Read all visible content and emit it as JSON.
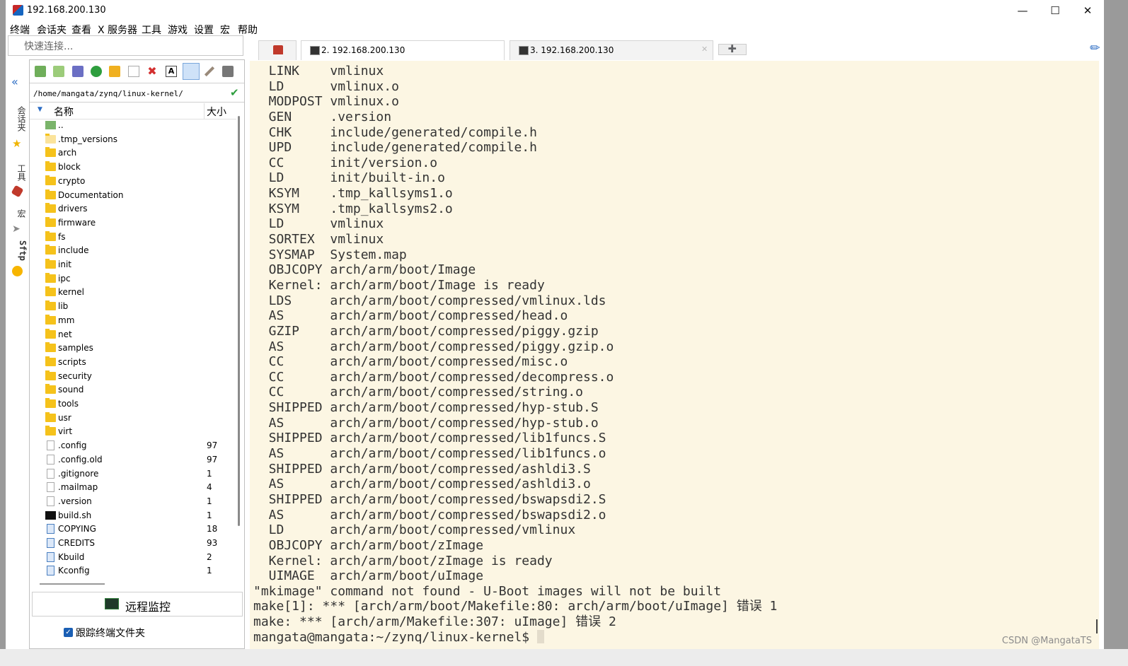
{
  "window": {
    "title": "192.168.200.130"
  },
  "menu": [
    "终端",
    "会话夹",
    "查看",
    "X 服务器",
    "工具",
    "游戏",
    "设置",
    "宏",
    "帮助"
  ],
  "quick_connect": {
    "placeholder": "快速连接..."
  },
  "side_tabs": [
    "会话夹",
    "工具",
    "宏",
    "Sftp"
  ],
  "sftp": {
    "path": "/home/mangata/zynq/linux-kernel/",
    "col_name": "名称",
    "col_size": "大小",
    "files": [
      {
        "name": "..",
        "size": "",
        "type": "up"
      },
      {
        "name": ".tmp_versions",
        "size": "",
        "type": "folder-light"
      },
      {
        "name": "arch",
        "size": "",
        "type": "folder"
      },
      {
        "name": "block",
        "size": "",
        "type": "folder"
      },
      {
        "name": "crypto",
        "size": "",
        "type": "folder"
      },
      {
        "name": "Documentation",
        "size": "",
        "type": "folder"
      },
      {
        "name": "drivers",
        "size": "",
        "type": "folder"
      },
      {
        "name": "firmware",
        "size": "",
        "type": "folder"
      },
      {
        "name": "fs",
        "size": "",
        "type": "folder"
      },
      {
        "name": "include",
        "size": "",
        "type": "folder"
      },
      {
        "name": "init",
        "size": "",
        "type": "folder"
      },
      {
        "name": "ipc",
        "size": "",
        "type": "folder"
      },
      {
        "name": "kernel",
        "size": "",
        "type": "folder"
      },
      {
        "name": "lib",
        "size": "",
        "type": "folder"
      },
      {
        "name": "mm",
        "size": "",
        "type": "folder"
      },
      {
        "name": "net",
        "size": "",
        "type": "folder"
      },
      {
        "name": "samples",
        "size": "",
        "type": "folder"
      },
      {
        "name": "scripts",
        "size": "",
        "type": "folder"
      },
      {
        "name": "security",
        "size": "",
        "type": "folder"
      },
      {
        "name": "sound",
        "size": "",
        "type": "folder"
      },
      {
        "name": "tools",
        "size": "",
        "type": "folder"
      },
      {
        "name": "usr",
        "size": "",
        "type": "folder"
      },
      {
        "name": "virt",
        "size": "",
        "type": "folder"
      },
      {
        "name": ".config",
        "size": "97",
        "type": "file"
      },
      {
        "name": ".config.old",
        "size": "97",
        "type": "file"
      },
      {
        "name": ".gitignore",
        "size": "1",
        "type": "file"
      },
      {
        "name": ".mailmap",
        "size": "4",
        "type": "file"
      },
      {
        "name": ".version",
        "size": "1",
        "type": "file"
      },
      {
        "name": "build.sh",
        "size": "1",
        "type": "script"
      },
      {
        "name": "COPYING",
        "size": "18",
        "type": "doc"
      },
      {
        "name": "CREDITS",
        "size": "93",
        "type": "doc"
      },
      {
        "name": "Kbuild",
        "size": "2",
        "type": "doc"
      },
      {
        "name": "Kconfig",
        "size": "1",
        "type": "doc"
      }
    ],
    "monitor_label": "远程监控",
    "follow_label": "跟踪终端文件夹",
    "follow_checked": true
  },
  "tabs": [
    {
      "label": "",
      "icon": "home-icon"
    },
    {
      "label": "2. 192.168.200.130",
      "icon": "terminal-icon",
      "active": true
    },
    {
      "label": "3. 192.168.200.130",
      "icon": "terminal-icon",
      "active": false
    },
    {
      "label": "",
      "icon": "new-tab-icon"
    }
  ],
  "terminal": {
    "lines": [
      "  LINK    vmlinux",
      "  LD      vmlinux.o",
      "  MODPOST vmlinux.o",
      "  GEN     .version",
      "  CHK     include/generated/compile.h",
      "  UPD     include/generated/compile.h",
      "  CC      init/version.o",
      "  LD      init/built-in.o",
      "  KSYM    .tmp_kallsyms1.o",
      "  KSYM    .tmp_kallsyms2.o",
      "  LD      vmlinux",
      "  SORTEX  vmlinux",
      "  SYSMAP  System.map",
      "  OBJCOPY arch/arm/boot/Image",
      "  Kernel: arch/arm/boot/Image is ready",
      "  LDS     arch/arm/boot/compressed/vmlinux.lds",
      "  AS      arch/arm/boot/compressed/head.o",
      "  GZIP    arch/arm/boot/compressed/piggy.gzip",
      "  AS      arch/arm/boot/compressed/piggy.gzip.o",
      "  CC      arch/arm/boot/compressed/misc.o",
      "  CC      arch/arm/boot/compressed/decompress.o",
      "  CC      arch/arm/boot/compressed/string.o",
      "  SHIPPED arch/arm/boot/compressed/hyp-stub.S",
      "  AS      arch/arm/boot/compressed/hyp-stub.o",
      "  SHIPPED arch/arm/boot/compressed/lib1funcs.S",
      "  AS      arch/arm/boot/compressed/lib1funcs.o",
      "  SHIPPED arch/arm/boot/compressed/ashldi3.S",
      "  AS      arch/arm/boot/compressed/ashldi3.o",
      "  SHIPPED arch/arm/boot/compressed/bswapsdi2.S",
      "  AS      arch/arm/boot/compressed/bswapsdi2.o",
      "  LD      arch/arm/boot/compressed/vmlinux",
      "  OBJCOPY arch/arm/boot/zImage",
      "  Kernel: arch/arm/boot/zImage is ready",
      "  UIMAGE  arch/arm/boot/uImage",
      "\"mkimage\" command not found - U-Boot images will not be built",
      "make[1]: *** [arch/arm/boot/Makefile:80: arch/arm/boot/uImage] 错误 1",
      "make: *** [arch/arm/Makefile:307: uImage] 错误 2"
    ],
    "prompt": "mangata@mangata:~/zynq/linux-kernel$ "
  },
  "watermark": "CSDN @MangataTS"
}
